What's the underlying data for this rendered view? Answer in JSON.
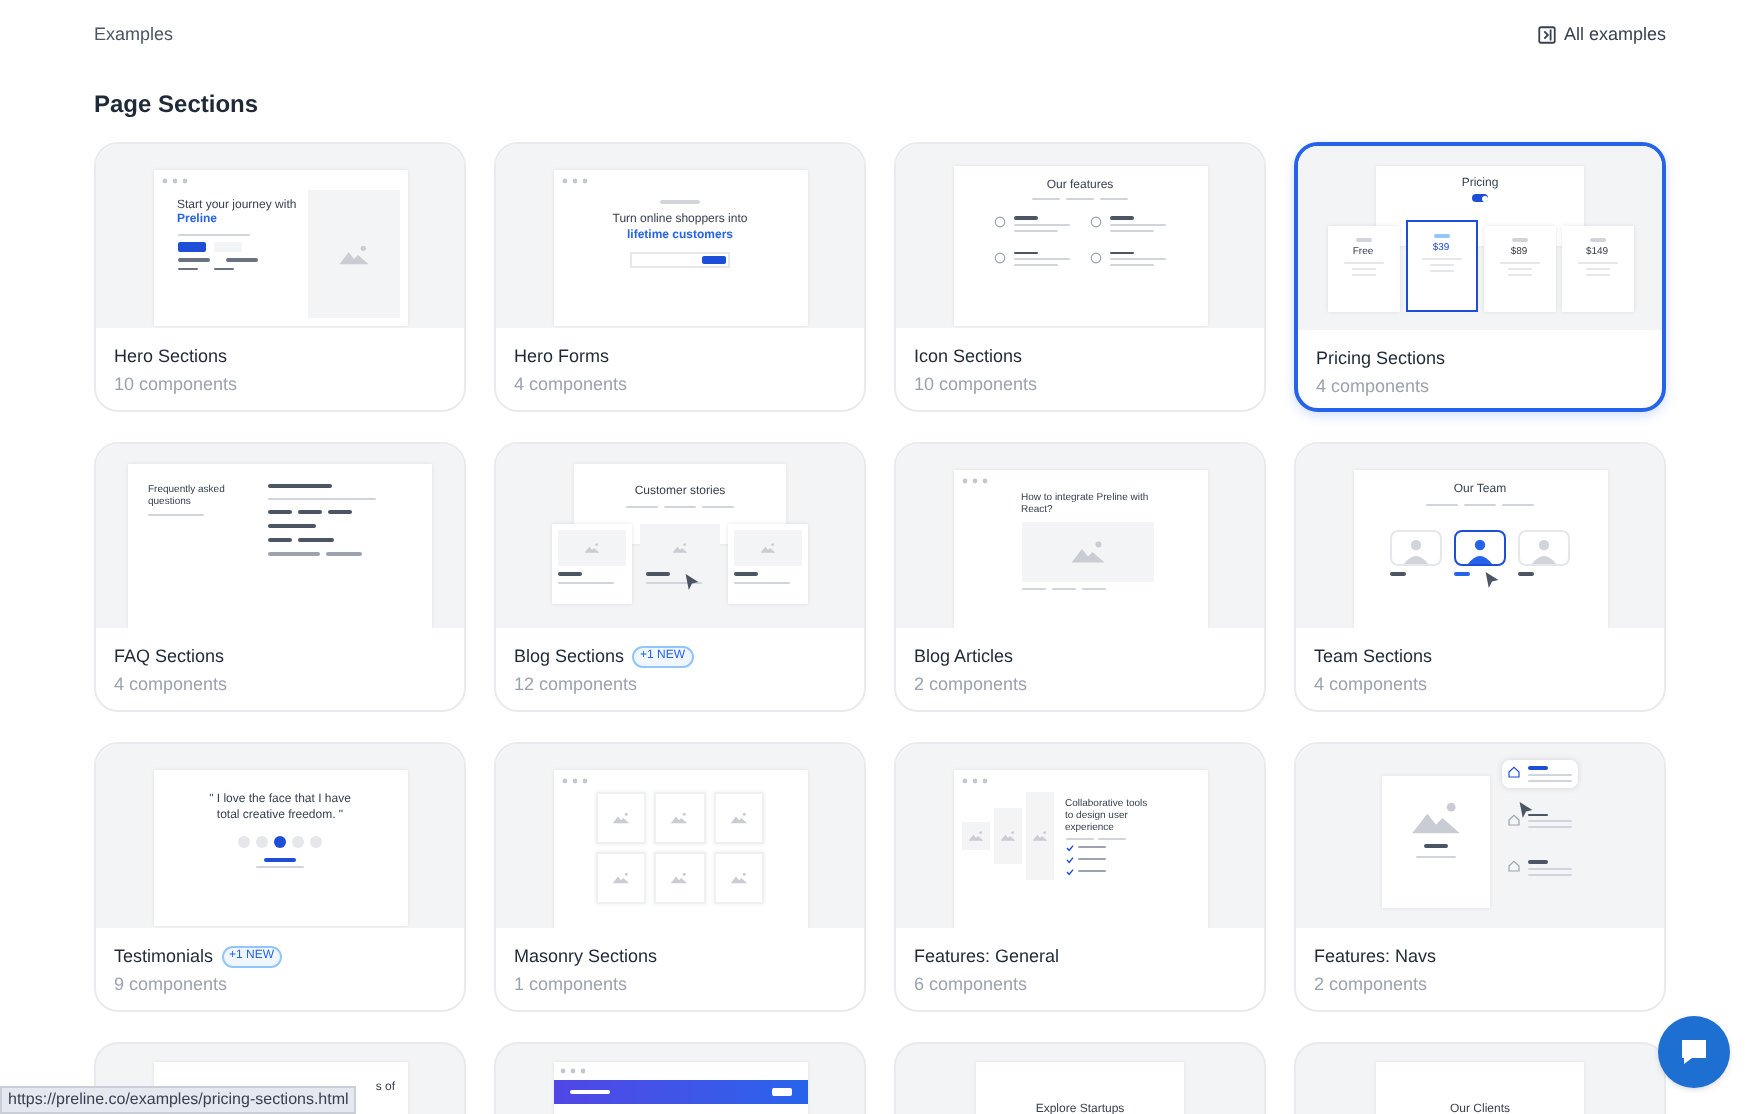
{
  "header": {
    "title": "Examples",
    "link": "All examples"
  },
  "section_title": "Page Sections",
  "cards": [
    {
      "kind": "hero",
      "title": "Hero Sections",
      "count": "10 components",
      "selected": false,
      "preview": {
        "heading": "Start your journey with",
        "highlight": "Preline"
      }
    },
    {
      "kind": "form",
      "title": "Hero Forms",
      "count": "4 components",
      "selected": false,
      "preview": {
        "heading": "Turn online shoppers into",
        "highlight": "lifetime customers"
      }
    },
    {
      "kind": "icons",
      "title": "Icon Sections",
      "count": "10 components",
      "selected": false,
      "preview": {
        "heading": "Our features"
      }
    },
    {
      "kind": "pricing",
      "title": "Pricing Sections",
      "count": "4 components",
      "selected": true,
      "preview": {
        "heading": "Pricing",
        "toggle_on": true,
        "prices": [
          "Free",
          "$39",
          "$89",
          "$149"
        ]
      }
    },
    {
      "kind": "faq",
      "title": "FAQ Sections",
      "count": "4 components",
      "selected": false,
      "preview": {
        "heading": "Frequently asked questions"
      }
    },
    {
      "kind": "blog",
      "title": "Blog Sections",
      "badge": "+1 NEW",
      "count": "12 components",
      "selected": false,
      "preview": {
        "heading": "Customer stories"
      }
    },
    {
      "kind": "article",
      "title": "Blog Articles",
      "count": "2 components",
      "selected": false,
      "preview": {
        "heading": "How to integrate Preline with React?"
      }
    },
    {
      "kind": "team",
      "title": "Team Sections",
      "count": "4 components",
      "selected": false,
      "preview": {
        "heading": "Our Team"
      }
    },
    {
      "kind": "quote",
      "title": "Testimonials",
      "badge": "+1 NEW",
      "count": "9 components",
      "selected": false,
      "preview": {
        "heading": "\" I love the face that I have total creative freedom. \""
      }
    },
    {
      "kind": "masonry",
      "title": "Masonry Sections",
      "count": "1 components",
      "selected": false
    },
    {
      "kind": "features",
      "title": "Features: General",
      "count": "6 components",
      "selected": false,
      "preview": {
        "heading": "Collaborative tools to design user experience"
      }
    },
    {
      "kind": "navs",
      "title": "Features: Navs",
      "count": "2 components",
      "selected": false
    }
  ],
  "partial_cards": [
    {
      "kind": "text_right",
      "text": "s of"
    },
    {
      "kind": "banner"
    },
    {
      "kind": "text_center",
      "text": "Explore Startups"
    },
    {
      "kind": "text_center",
      "text": "Our Clients"
    }
  ],
  "status_url": "https://preline.co/examples/pricing-sections.html"
}
